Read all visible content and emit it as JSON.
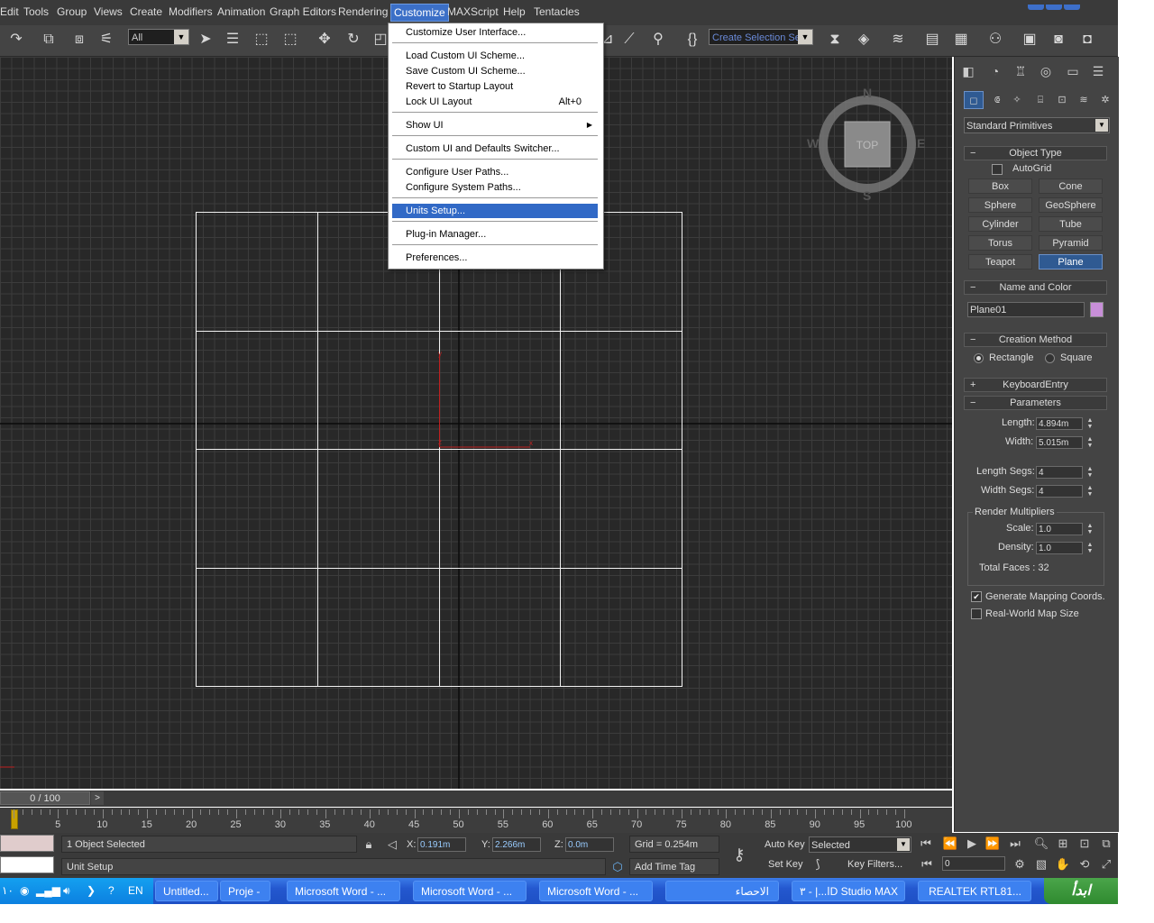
{
  "menubar": {
    "items": [
      "Edit",
      "Tools",
      "Group",
      "Views",
      "Create",
      "Modifiers",
      "Animation",
      "Graph Editors",
      "Rendering",
      "Customize",
      "MAXScript",
      "Help",
      "Tentacles"
    ],
    "active": "Customize"
  },
  "toolbar": {
    "filter_value": "All",
    "selection_set_value": "Create Selection Se"
  },
  "customize_menu": {
    "customize_ui": "Customize User Interface...",
    "load_scheme": "Load Custom UI Scheme...",
    "save_scheme": "Save Custom UI Scheme...",
    "revert_layout": "Revert to Startup Layout",
    "lock_layout": "Lock UI Layout",
    "lock_shortcut": "Alt+0",
    "show_ui": "Show UI",
    "switcher": "Custom UI and Defaults Switcher...",
    "user_paths": "Configure User Paths...",
    "system_paths": "Configure System Paths...",
    "units_setup": "Units Setup...",
    "plugin_manager": "Plug-in Manager...",
    "preferences": "Preferences..."
  },
  "viewport": {
    "viewcube_label": "TOP",
    "compass": {
      "n": "N",
      "s": "S",
      "e": "E",
      "w": "W"
    },
    "axis": {
      "x": "x",
      "y": "y",
      "z": "z"
    }
  },
  "command_panel": {
    "category_dropdown": "Standard Primitives",
    "object_type": {
      "title": "Object Type",
      "autogrid": "AutoGrid",
      "buttons": [
        "Box",
        "Cone",
        "Sphere",
        "GeoSphere",
        "Cylinder",
        "Tube",
        "Torus",
        "Pyramid",
        "Teapot",
        "Plane"
      ],
      "selected": "Plane"
    },
    "name_color": {
      "title": "Name and Color",
      "name": "Plane01",
      "color": "#c88fd8"
    },
    "creation_method": {
      "title": "Creation Method",
      "rectangle": "Rectangle",
      "square": "Square"
    },
    "keyboard_entry": {
      "title": "KeyboardEntry"
    },
    "parameters": {
      "title": "Parameters",
      "length_label": "Length:",
      "length": "4.894m",
      "width_label": "Width:",
      "width": "5.015m",
      "length_segs_label": "Length Segs:",
      "length_segs": "4",
      "width_segs_label": "Width Segs:",
      "width_segs": "4",
      "render_multipliers": "Render Multipliers",
      "scale_label": "Scale:",
      "scale": "1.0",
      "density_label": "Density:",
      "density": "1.0",
      "total_faces": "Total Faces : 32",
      "gen_mapping": "Generate Mapping Coords.",
      "real_world": "Real-World Map Size"
    },
    "roll_minus": "−",
    "roll_plus": "+"
  },
  "timeline": {
    "position": "0 / 100",
    "next": ">",
    "ticks": [
      "5",
      "10",
      "15",
      "20",
      "25",
      "30",
      "35",
      "40",
      "45",
      "50",
      "55",
      "60",
      "65",
      "70",
      "75",
      "80",
      "85",
      "90",
      "95",
      "100"
    ]
  },
  "status": {
    "selected": "1 Object Selected",
    "prompt": "Unit Setup",
    "x_label": "X:",
    "x": "0.191m",
    "y_label": "Y:",
    "y": "2.266m",
    "z_label": "Z:",
    "z": "0.0m",
    "grid": "Grid = 0.254m",
    "add_time_tag": "Add Time Tag",
    "auto_key": "Auto Key",
    "key_mode": "Selected",
    "set_key": "Set Key",
    "key_filters": "Key Filters...",
    "frame": "0"
  },
  "taskbar": {
    "clock": "١٠",
    "lang": "EN",
    "buttons": [
      "Untitled...",
      "Proje -",
      "Microsoft Word - ...",
      "Microsoft Word - ...",
      "Microsoft Word - ...",
      "الاحصاء",
      "ا...| - ٣D Studio MAX",
      "REALTEK RTL81..."
    ],
    "start": "ابدأ"
  }
}
